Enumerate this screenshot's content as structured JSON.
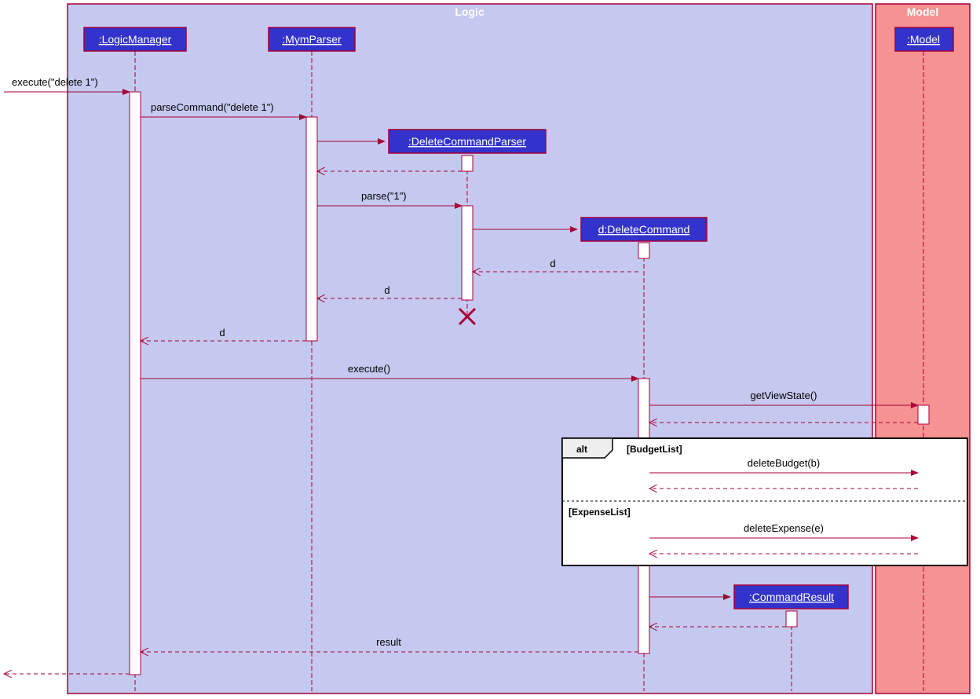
{
  "boxes": {
    "logic_label": "Logic",
    "model_label": "Model"
  },
  "participants": {
    "logicManager": ":LogicManager",
    "mymParser": ":MymParser",
    "deleteCommandParser": ":DeleteCommandParser",
    "deleteCommand": "d:DeleteCommand",
    "commandResult": ":CommandResult",
    "model": ":Model"
  },
  "messages": {
    "executeDelete1": "execute(\"delete 1\")",
    "parseCommand": "parseCommand(\"delete 1\")",
    "parse1": "parse(\"1\")",
    "d1": "d",
    "d2": "d",
    "d3": "d",
    "execute": "execute()",
    "getViewState": "getViewState()",
    "deleteBudget": "deleteBudget(b)",
    "deleteExpense": "deleteExpense(e)",
    "result": "result"
  },
  "alt": {
    "label": "alt",
    "cond1": "[BudgetList]",
    "cond2": "[ExpenseList]"
  }
}
